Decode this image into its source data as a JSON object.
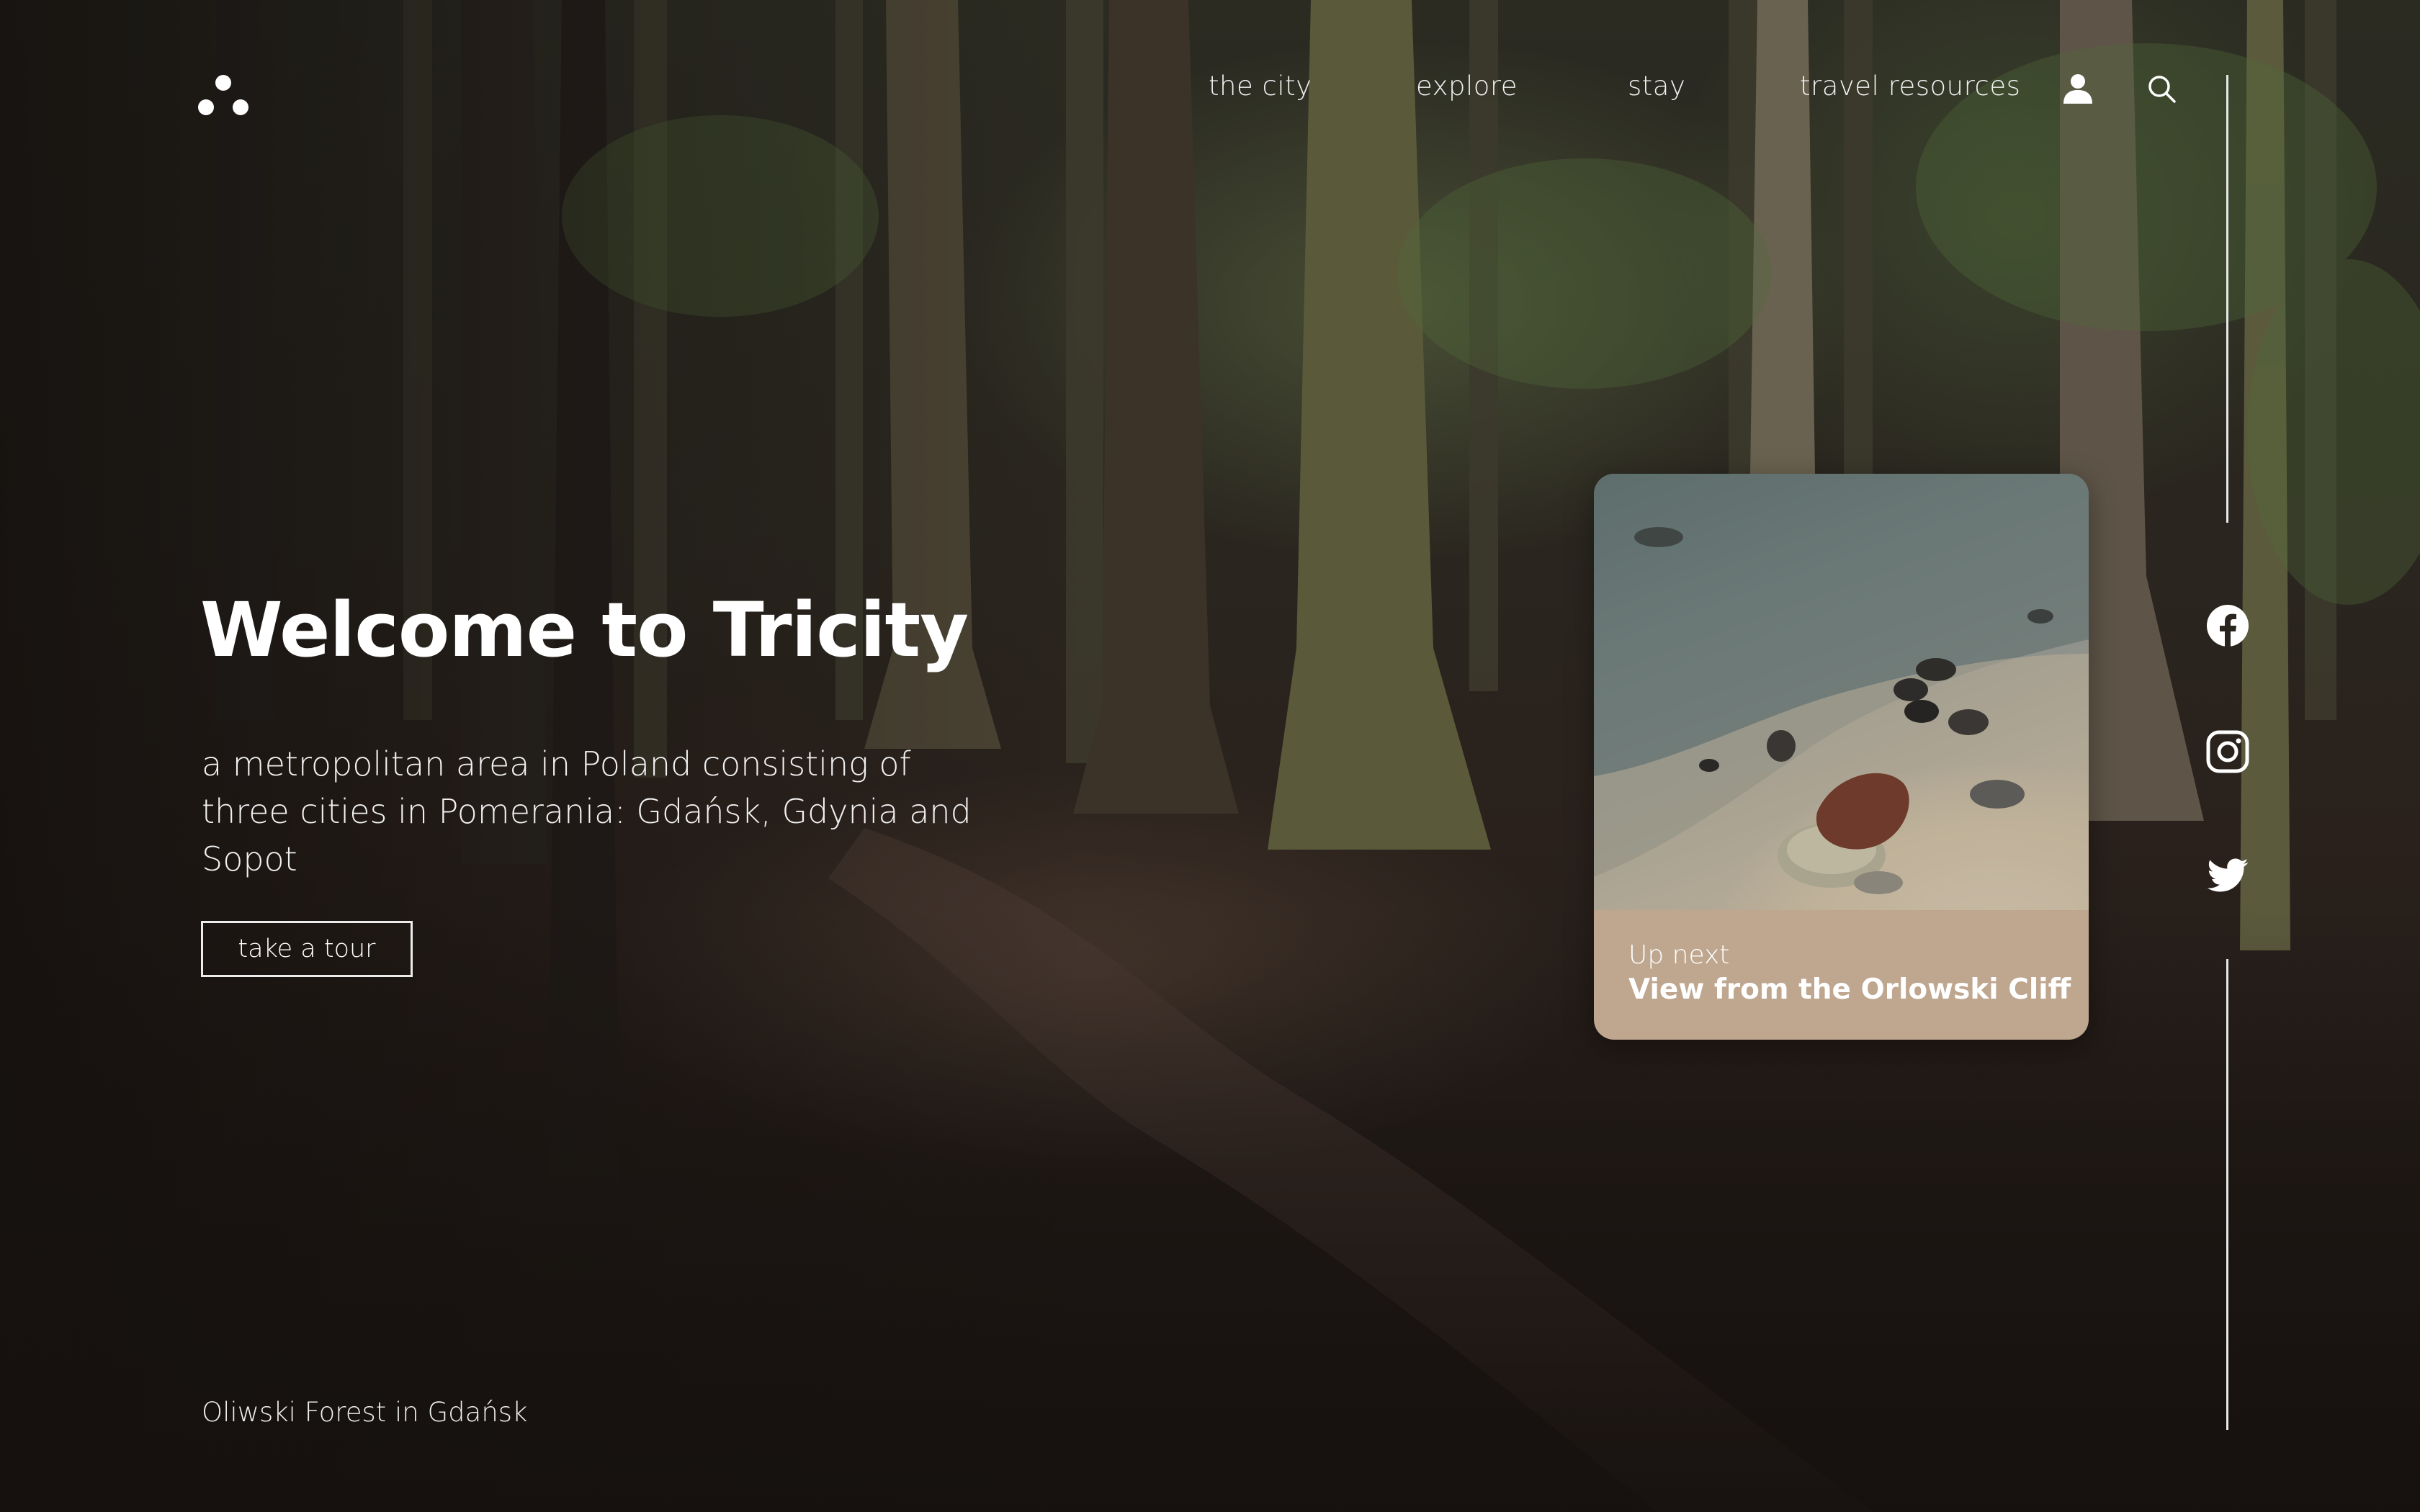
{
  "nav": {
    "items": [
      {
        "label": "the city"
      },
      {
        "label": "explore"
      },
      {
        "label": "stay"
      },
      {
        "label": "travel resources"
      }
    ],
    "icons": [
      "user-icon",
      "search-icon"
    ]
  },
  "hero": {
    "title": "Welcome to Tricity",
    "subtitle": "a metropolitan area in Poland consisting of three cities in Pomerania: Gdańsk, Gdynia and Sopot",
    "cta_label": "take a tour"
  },
  "up_next": {
    "label": "Up next",
    "title": "View from the Orlowski Cliff"
  },
  "social": [
    "facebook-icon",
    "instagram-icon",
    "twitter-icon"
  ],
  "location_caption": "Oliwski Forest in Gdańsk",
  "colors": {
    "card_caption_bg": "#bea68f",
    "text": "#ffffff",
    "background": "#1c1714"
  }
}
